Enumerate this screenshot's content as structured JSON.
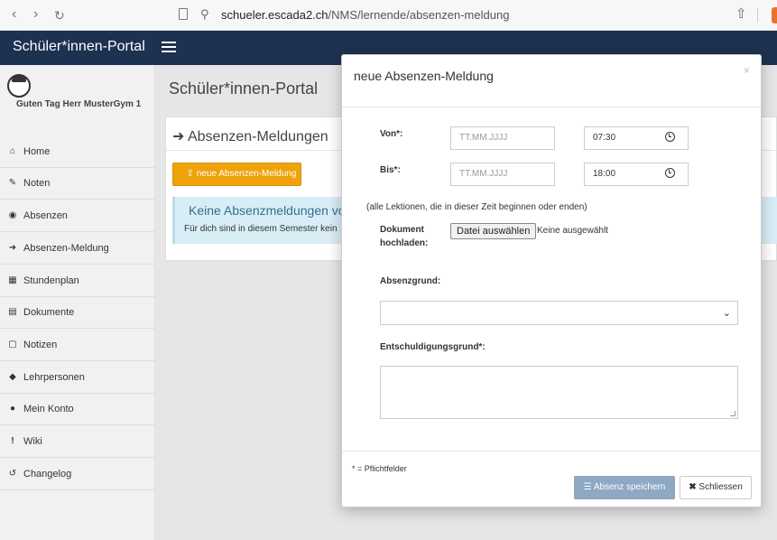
{
  "browser": {
    "url_domain": "schueler.escada2.ch",
    "url_path": "/NMS/lernende/absenzen-meldung",
    "icons": {
      "back": "chevron-left",
      "forward": "chevron-right",
      "reload": "reload",
      "bookmark": "bookmark",
      "site": "site-settings",
      "share": "share"
    }
  },
  "header": {
    "brand": "Schüler*innen-Portal"
  },
  "sidebar": {
    "greeting": "Guten Tag Herr MusterGym 1",
    "items": [
      {
        "icon": "home-icon",
        "glyph": "⌂",
        "label": "Home"
      },
      {
        "icon": "pencil-icon",
        "glyph": "✎",
        "label": "Noten"
      },
      {
        "icon": "eye-slash-icon",
        "glyph": "◉",
        "label": "Absenzen"
      },
      {
        "icon": "sign-in-icon",
        "glyph": "➜",
        "label": "Absenzen-Meldung"
      },
      {
        "icon": "calendar-icon",
        "glyph": "▦",
        "label": "Stundenplan"
      },
      {
        "icon": "file-icon",
        "glyph": "▤",
        "label": "Dokumente"
      },
      {
        "icon": "file-outline-icon",
        "glyph": "▢",
        "label": "Notizen"
      },
      {
        "icon": "graduation-cap-icon",
        "glyph": "◆",
        "label": "Lehrpersonen"
      },
      {
        "icon": "user-icon",
        "glyph": "●",
        "label": "Mein Konto"
      },
      {
        "icon": "exclamation-icon",
        "glyph": "!",
        "label": "Wiki"
      },
      {
        "icon": "history-icon",
        "glyph": "↺",
        "label": "Changelog"
      }
    ]
  },
  "main": {
    "title": "Schüler*innen-Portal",
    "card_title": "Absenzen-Meldungen",
    "new_button": "neue Absenzen-Meldung",
    "alert_title": "Keine Absenzmeldungen vorh",
    "alert_text": "Für dich sind in diesem Semester kein"
  },
  "modal": {
    "title": "neue Absenzen-Meldung",
    "close_glyph": "×",
    "von_label": "Von*:",
    "bis_label": "Bis*:",
    "date_placeholder": "TT.MM.JJJJ",
    "von_time": "07:30",
    "bis_time": "18:00",
    "note": "(alle Lektionen, die in dieser Zeit beginnen oder enden)",
    "dokument_label_1": "Dokument",
    "dokument_label_2": "hochladen:",
    "file_button": "Datei auswählen",
    "file_status": "Keine ausgewählt",
    "absenzgrund_label": "Absenzgrund:",
    "entschuldigung_label": "Entschuldigungsgrund*:",
    "required_note": "* = Pflichtfelder",
    "save_button": "Absenz speichern",
    "close_button": "Schliessen"
  },
  "colors": {
    "header": "#1d3150",
    "orange": "#f0a20a",
    "alert_bg": "#d9edf7",
    "save_btn": "#8fa8c4"
  }
}
